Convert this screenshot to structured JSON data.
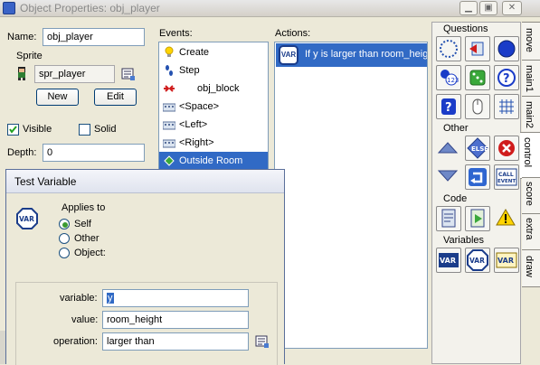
{
  "window": {
    "title": "Object Properties: obj_player"
  },
  "object": {
    "name_label": "Name:",
    "name_value": "obj_player",
    "sprite_label": "Sprite",
    "sprite_value": "spr_player",
    "new_label": "New",
    "edit_label": "Edit",
    "visible_label": "Visible",
    "visible_checked": true,
    "solid_label": "Solid",
    "solid_checked": false,
    "depth_label": "Depth:",
    "depth_value": "0"
  },
  "events": {
    "label": "Events:",
    "items": [
      {
        "label": "Create",
        "icon": "lightbulb-icon",
        "selected": false
      },
      {
        "label": "Step",
        "icon": "footsteps-icon",
        "selected": false
      },
      {
        "label": "obj_block",
        "icon": "collision-icon",
        "selected": false
      },
      {
        "label": "<Space>",
        "icon": "keyboard-icon",
        "selected": false
      },
      {
        "label": "<Left>",
        "icon": "keyboard-icon",
        "selected": false
      },
      {
        "label": "<Right>",
        "icon": "keyboard-icon",
        "selected": false
      },
      {
        "label": "Outside Room",
        "icon": "diamond-icon",
        "selected": true
      }
    ]
  },
  "actions": {
    "label": "Actions:",
    "items": [
      {
        "label": "If y is larger than room_height",
        "icon": "var-icon",
        "selected": true
      }
    ]
  },
  "palette": {
    "questions_label": "Questions",
    "other_label": "Other",
    "code_label": "Code",
    "variables_label": "Variables",
    "else_text": "ELSE",
    "call_text": "CALL EVENT",
    "var_text": "VAR",
    "tabs": [
      "move",
      "main1",
      "main2",
      "control",
      "score",
      "extra",
      "draw"
    ],
    "active_tab": "control"
  },
  "dialog": {
    "title": "Test Variable",
    "applies_label": "Applies to",
    "var_badge": "VAR",
    "options": [
      {
        "label": "Self",
        "selected": true
      },
      {
        "label": "Other",
        "selected": false
      },
      {
        "label": "Object:",
        "selected": false
      }
    ],
    "variable_label": "variable:",
    "variable_value": "y",
    "value_label": "value:",
    "value_value": "room_height",
    "operation_label": "operation:",
    "operation_value": "larger than"
  },
  "colors": {
    "selection": "#316ac5",
    "accent_blue": "#1a3c8a"
  }
}
